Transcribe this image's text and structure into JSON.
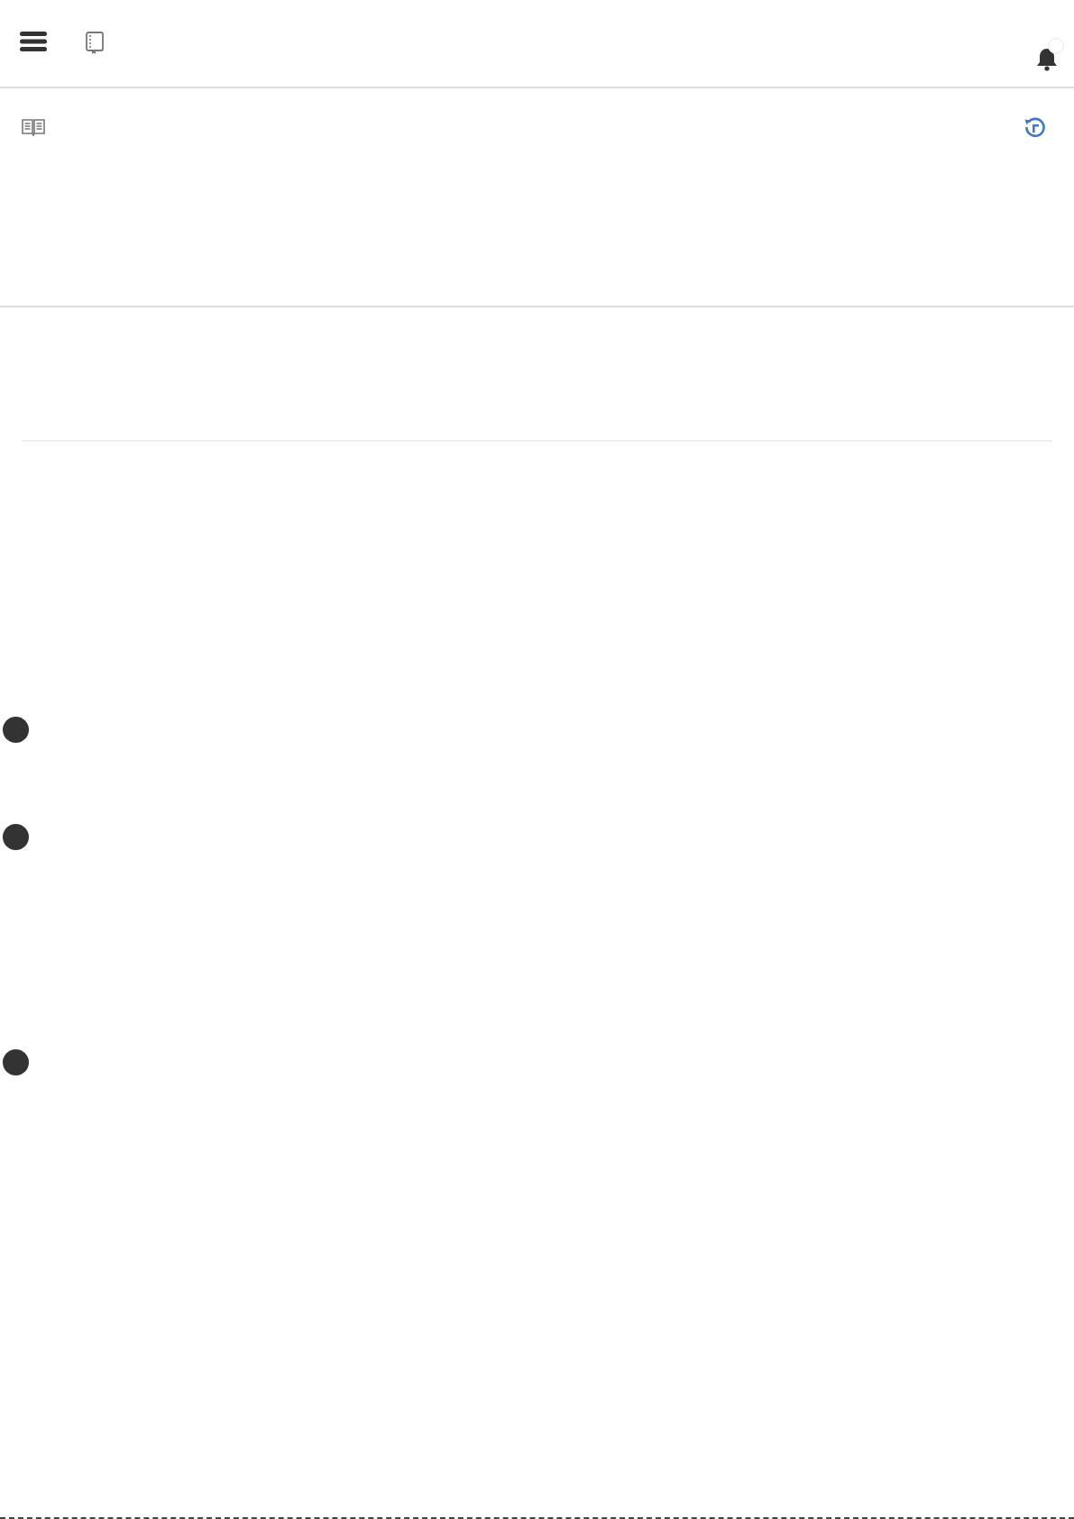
{
  "header": {
    "notification_badge": true
  },
  "list": [
    {
      "kind": "bullet"
    },
    {
      "kind": "bullet"
    },
    {
      "kind": "bullet"
    }
  ]
}
